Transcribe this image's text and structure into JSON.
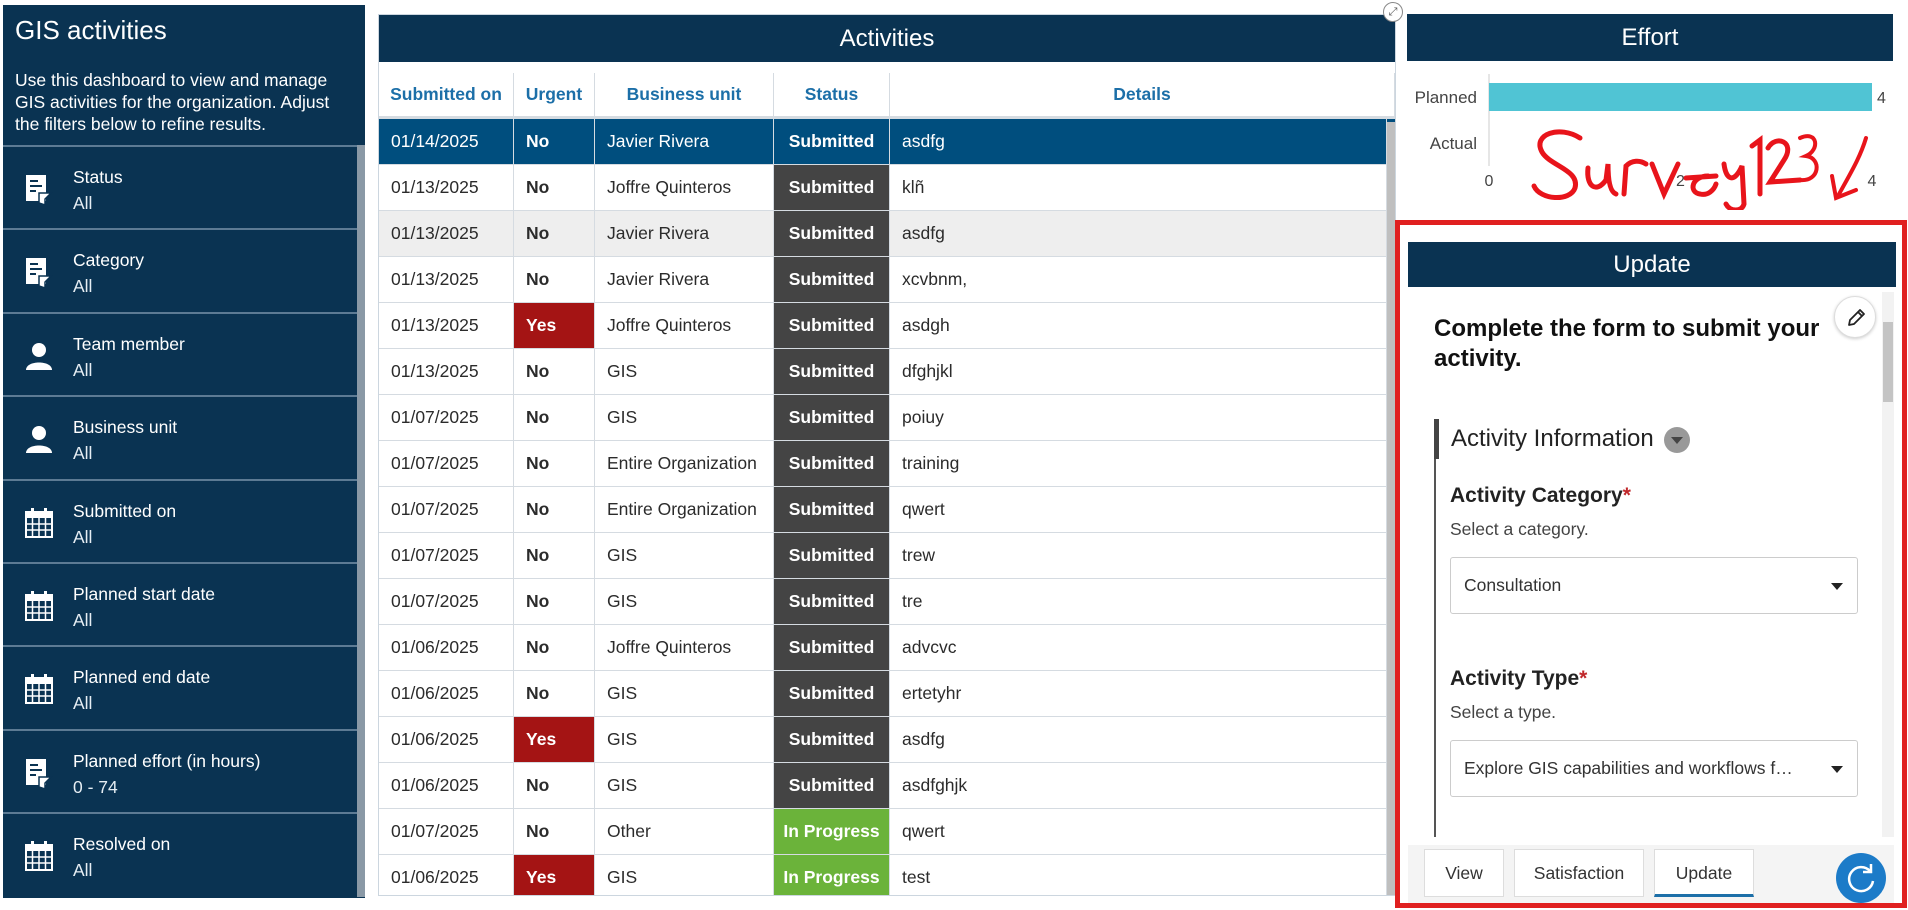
{
  "sidebar": {
    "title": "GIS activities",
    "description": "Use this dashboard to view and manage GIS activities for the organization. Adjust the filters below to refine results.",
    "filters": [
      {
        "name": "Status",
        "value": "All",
        "icon": "filter-list-icon"
      },
      {
        "name": "Category",
        "value": "All",
        "icon": "filter-list-icon"
      },
      {
        "name": "Team member",
        "value": "All",
        "icon": "person-icon"
      },
      {
        "name": "Business unit",
        "value": "All",
        "icon": "person-icon"
      },
      {
        "name": "Submitted on",
        "value": "All",
        "icon": "calendar-icon"
      },
      {
        "name": "Planned start date",
        "value": "All",
        "icon": "calendar-icon"
      },
      {
        "name": "Planned end date",
        "value": "All",
        "icon": "calendar-icon"
      },
      {
        "name": "Planned effort (in hours)",
        "value": "0 - 74",
        "icon": "filter-list-icon"
      },
      {
        "name": "Resolved on",
        "value": "All",
        "icon": "calendar-icon"
      }
    ]
  },
  "activities": {
    "title": "Activities",
    "columns": [
      "Submitted on",
      "Urgent",
      "Business unit",
      "Status",
      "Details"
    ],
    "rows": [
      {
        "date": "01/14/2025",
        "urgent": "No",
        "unit": "Javier Rivera",
        "status": "Submitted",
        "details": "asdfg"
      },
      {
        "date": "01/13/2025",
        "urgent": "No",
        "unit": "Joffre Quinteros",
        "status": "Submitted",
        "details": "klñ"
      },
      {
        "date": "01/13/2025",
        "urgent": "No",
        "unit": "Javier Rivera",
        "status": "Submitted",
        "details": "asdfg"
      },
      {
        "date": "01/13/2025",
        "urgent": "No",
        "unit": "Javier Rivera",
        "status": "Submitted",
        "details": "xcvbnm,"
      },
      {
        "date": "01/13/2025",
        "urgent": "Yes",
        "unit": "Joffre Quinteros",
        "status": "Submitted",
        "details": "asdgh"
      },
      {
        "date": "01/13/2025",
        "urgent": "No",
        "unit": "GIS",
        "status": "Submitted",
        "details": "dfghjkl"
      },
      {
        "date": "01/07/2025",
        "urgent": "No",
        "unit": "GIS",
        "status": "Submitted",
        "details": "poiuy"
      },
      {
        "date": "01/07/2025",
        "urgent": "No",
        "unit": "Entire Organization",
        "status": "Submitted",
        "details": "training"
      },
      {
        "date": "01/07/2025",
        "urgent": "No",
        "unit": "Entire Organization",
        "status": "Submitted",
        "details": "qwert"
      },
      {
        "date": "01/07/2025",
        "urgent": "No",
        "unit": "GIS",
        "status": "Submitted",
        "details": "trew"
      },
      {
        "date": "01/07/2025",
        "urgent": "No",
        "unit": "GIS",
        "status": "Submitted",
        "details": "tre"
      },
      {
        "date": "01/06/2025",
        "urgent": "No",
        "unit": "Joffre Quinteros",
        "status": "Submitted",
        "details": "advcvc"
      },
      {
        "date": "01/06/2025",
        "urgent": "No",
        "unit": "GIS",
        "status": "Submitted",
        "details": "ertetyhr"
      },
      {
        "date": "01/06/2025",
        "urgent": "Yes",
        "unit": "GIS",
        "status": "Submitted",
        "details": "asdfg"
      },
      {
        "date": "01/06/2025",
        "urgent": "No",
        "unit": "GIS",
        "status": "Submitted",
        "details": "asdfghjk"
      },
      {
        "date": "01/07/2025",
        "urgent": "No",
        "unit": "Other",
        "status": "In Progress",
        "details": "qwert"
      },
      {
        "date": "01/06/2025",
        "urgent": "Yes",
        "unit": "GIS",
        "status": "In Progress",
        "details": "test"
      }
    ]
  },
  "effort": {
    "title": "Effort",
    "annotation": "Survey123"
  },
  "chart_data": {
    "type": "bar",
    "orientation": "horizontal",
    "categories": [
      "Planned",
      "Actual"
    ],
    "values": [
      4,
      0
    ],
    "data_labels": [
      "4",
      ""
    ],
    "xlim": [
      0,
      4
    ],
    "x_ticks": [
      "0",
      "2",
      "4"
    ],
    "bar_color": "#50c4d4",
    "grid": false
  },
  "update": {
    "title": "Update",
    "intro": "Complete the form to submit your activity.",
    "section": "Activity Information",
    "fields": [
      {
        "label": "Activity Category",
        "hint": "Select a category.",
        "value": "Consultation"
      },
      {
        "label": "Activity Type",
        "hint": "Select a type.",
        "value": "Explore GIS capabilities and workflows f…"
      }
    ],
    "tabs": [
      "View",
      "Satisfaction",
      "Update"
    ]
  },
  "colors": {
    "navy": "#0a3352",
    "selected_row": "#004e7e",
    "urgent_yes": "#a41414",
    "status_submitted": "#444444",
    "status_in_progress": "#6bb33a",
    "highlight_border": "#e02020",
    "signature": "#e8141b"
  }
}
